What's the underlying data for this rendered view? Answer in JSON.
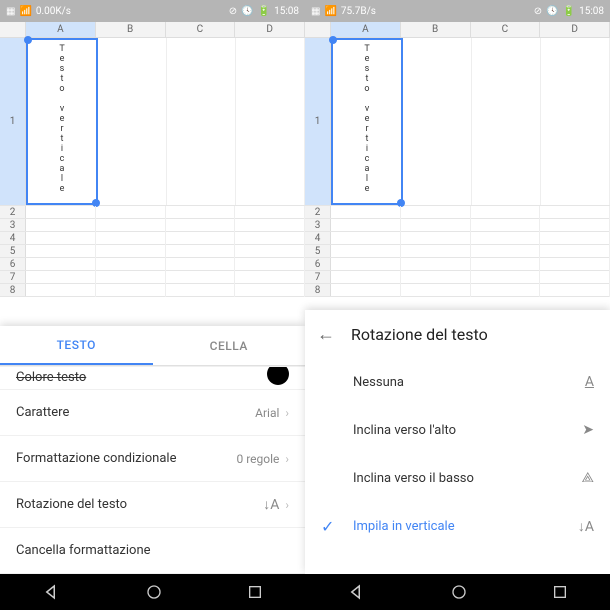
{
  "status": {
    "left_speed": "0.00K/s",
    "right_speed": "75.7B/s",
    "time": "15:08"
  },
  "sheet": {
    "cols": [
      "A",
      "B",
      "C",
      "D"
    ],
    "rows": [
      "1",
      "2",
      "3",
      "4",
      "5",
      "6",
      "7",
      "8"
    ],
    "vertical_text": "Testo verticale"
  },
  "left_panel": {
    "tabs": {
      "testo": "TESTO",
      "cella": "CELLA"
    },
    "color_row": "Colore testo",
    "carattere": {
      "label": "Carattere",
      "value": "Arial"
    },
    "cond": {
      "label": "Formattazione condizionale",
      "value": "0 regole"
    },
    "rotazione": {
      "label": "Rotazione del testo",
      "icon": "↓A"
    },
    "cancella": "Cancella formattazione"
  },
  "right_panel": {
    "title": "Rotazione del testo",
    "options": {
      "nessuna": "Nessuna",
      "up": "Inclina verso l'alto",
      "down": "Inclina verso il basso",
      "stack": "Impila in verticale"
    }
  }
}
